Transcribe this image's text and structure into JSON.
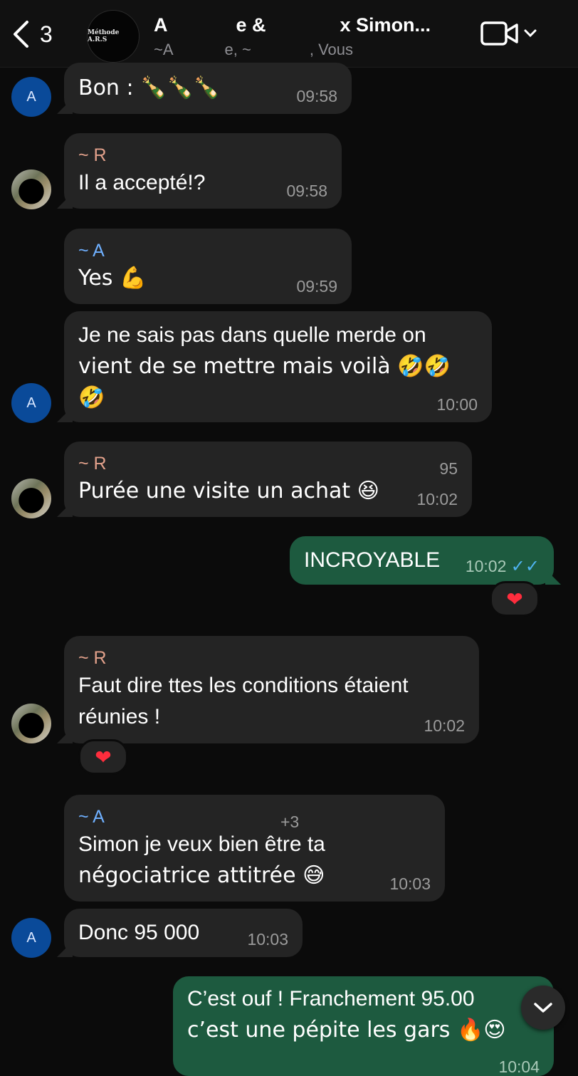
{
  "header": {
    "unread_count": "3",
    "group_avatar_text": "Méthode A.R.S",
    "title_start": "A",
    "title_mid": "e &",
    "title_end": "x Simon...",
    "members_start": "~A",
    "members_mid": "e, ~",
    "members_end": ", Vous"
  },
  "messages": [
    {
      "text": "Bon : 🍾🍾🍾",
      "time": "09:58"
    },
    {
      "sender": "~ R",
      "text": "Il a accepté!?",
      "time": "09:58"
    },
    {
      "sender": "~ A",
      "text": "Yes 💪",
      "time": "09:59"
    },
    {
      "text_line1": "Je ne sais pas dans quelle merde on",
      "text_line2": "vient de se mettre mais voilà 🤣🤣",
      "text_line3": "🤣",
      "time": "10:00"
    },
    {
      "sender": "~ R",
      "sender_suffix": "95",
      "text": "Purée une visite un achat 😆",
      "time": "10:02"
    },
    {
      "text": "INCROYABLE",
      "time": "10:02",
      "ticks": "✓✓",
      "reaction": "❤"
    },
    {
      "sender": "~ R",
      "text_line1": "Faut dire ttes les conditions étaient",
      "text_line2": "réunies !",
      "time": "10:02",
      "reaction": "❤"
    },
    {
      "sender": "~ A",
      "sender_suffix": "+3",
      "text_line1": "Simon je veux bien être ta",
      "text_line2": "négociatrice attitrée 😅",
      "time": "10:03"
    },
    {
      "text": "Donc 95 000",
      "time": "10:03"
    },
    {
      "text_line1": "C’est ouf ! Franchement 95.00",
      "text_line2": "c’est une pépite les gars 🔥😍",
      "time": "10:04"
    }
  ],
  "avatars": {
    "a_letter": "A"
  },
  "colors": {
    "outgoing": "#1d5a3f",
    "incoming": "#242424",
    "sender_r": "#e2a18b",
    "sender_a": "#6fb0ff",
    "read_ticks": "#4fb3f0"
  }
}
